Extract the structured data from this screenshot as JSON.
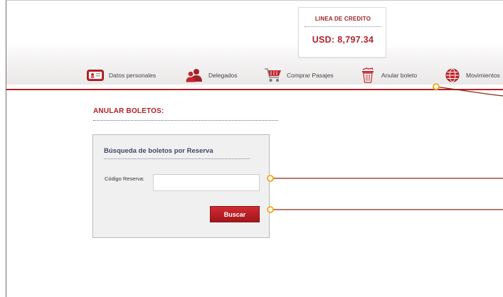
{
  "credit": {
    "title": "LINEA DE CREDITO",
    "value": "USD: 8,797.34"
  },
  "nav": {
    "items": [
      {
        "label": "Datos personales",
        "icon": "id-card-icon"
      },
      {
        "label": "Delegados",
        "icon": "users-icon"
      },
      {
        "label": "Comprar Pasajes",
        "icon": "cart-icon"
      },
      {
        "label": "Anular boleto",
        "icon": "trash-icon"
      },
      {
        "label": "Movimientos",
        "icon": "globe-icon"
      }
    ]
  },
  "page": {
    "title": "ANULAR BOLETOS:"
  },
  "search": {
    "title": "Búsqueda de boletos por Reserva",
    "field_label": "Código Reserva:",
    "field_value": "",
    "button_label": "Buscar"
  },
  "colors": {
    "accent": "#b31f24",
    "callout": "#8b2a12",
    "callout_dot": "#f0a000"
  }
}
